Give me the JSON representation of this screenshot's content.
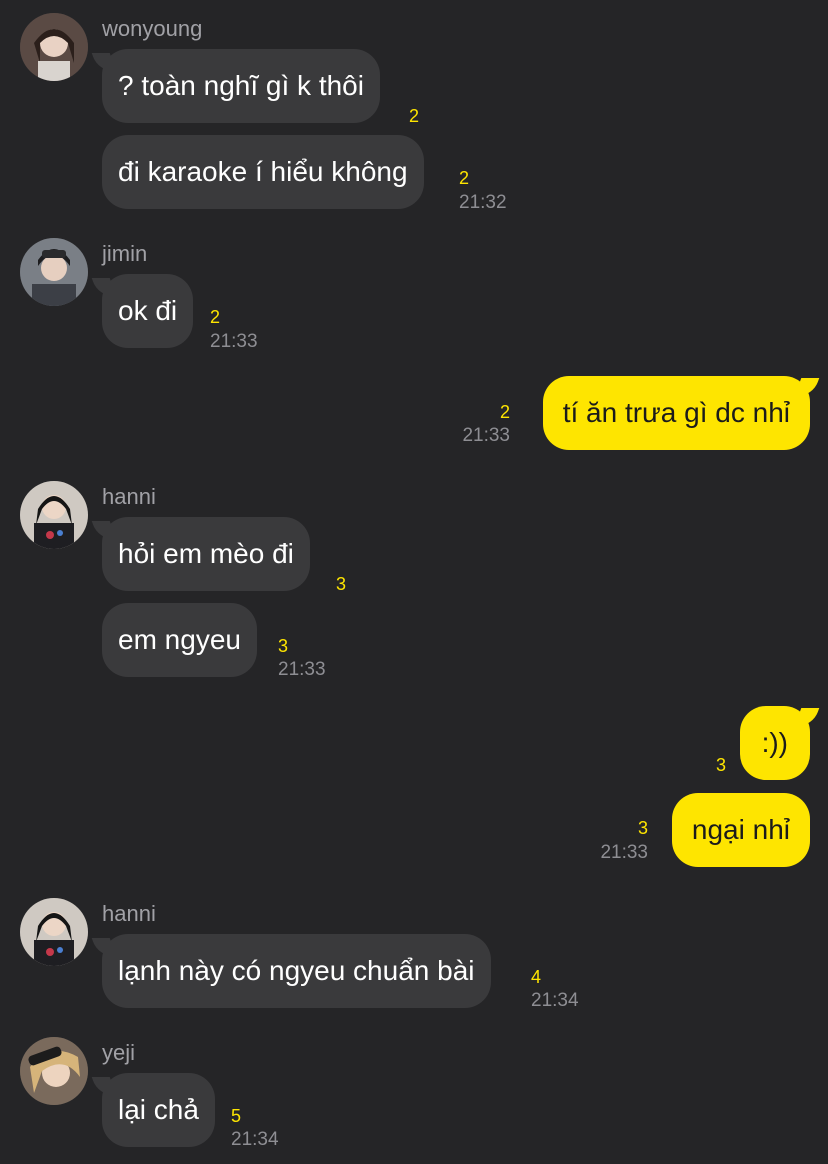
{
  "colors": {
    "background": "#252527",
    "incoming_bubble": "#3a3a3c",
    "outgoing_bubble": "#fee500",
    "unread_count": "#fee500",
    "timestamp": "#8e8e93"
  },
  "messages": {
    "g1": {
      "sender": "wonyoung",
      "m1": {
        "text": "? toàn nghĩ gì k thôi",
        "count": "2"
      },
      "m2": {
        "text": "đi karaoke í hiểu không",
        "count": "2",
        "time": "21:32"
      }
    },
    "g2": {
      "sender": "jimin",
      "m1": {
        "text": "ok đi",
        "count": "2",
        "time": "21:33"
      }
    },
    "g3": {
      "m1": {
        "text": "tí ăn trưa gì dc nhỉ",
        "count": "2",
        "time": "21:33"
      }
    },
    "g4": {
      "sender": "hanni",
      "m1": {
        "text": "hỏi em mèo đi",
        "count": "3"
      },
      "m2": {
        "text": "em ngyeu",
        "count": "3",
        "time": "21:33"
      }
    },
    "g5": {
      "m1": {
        "text": ":))",
        "count": "3"
      },
      "m2": {
        "text": "ngại nhỉ",
        "count": "3",
        "time": "21:33"
      }
    },
    "g6": {
      "sender": "hanni",
      "m1": {
        "text": "lạnh này có ngyeu chuẩn bài",
        "count": "4",
        "time": "21:34"
      }
    },
    "g7": {
      "sender": "yeji",
      "m1": {
        "text": "lại chả",
        "count": "5",
        "time": "21:34"
      }
    }
  }
}
